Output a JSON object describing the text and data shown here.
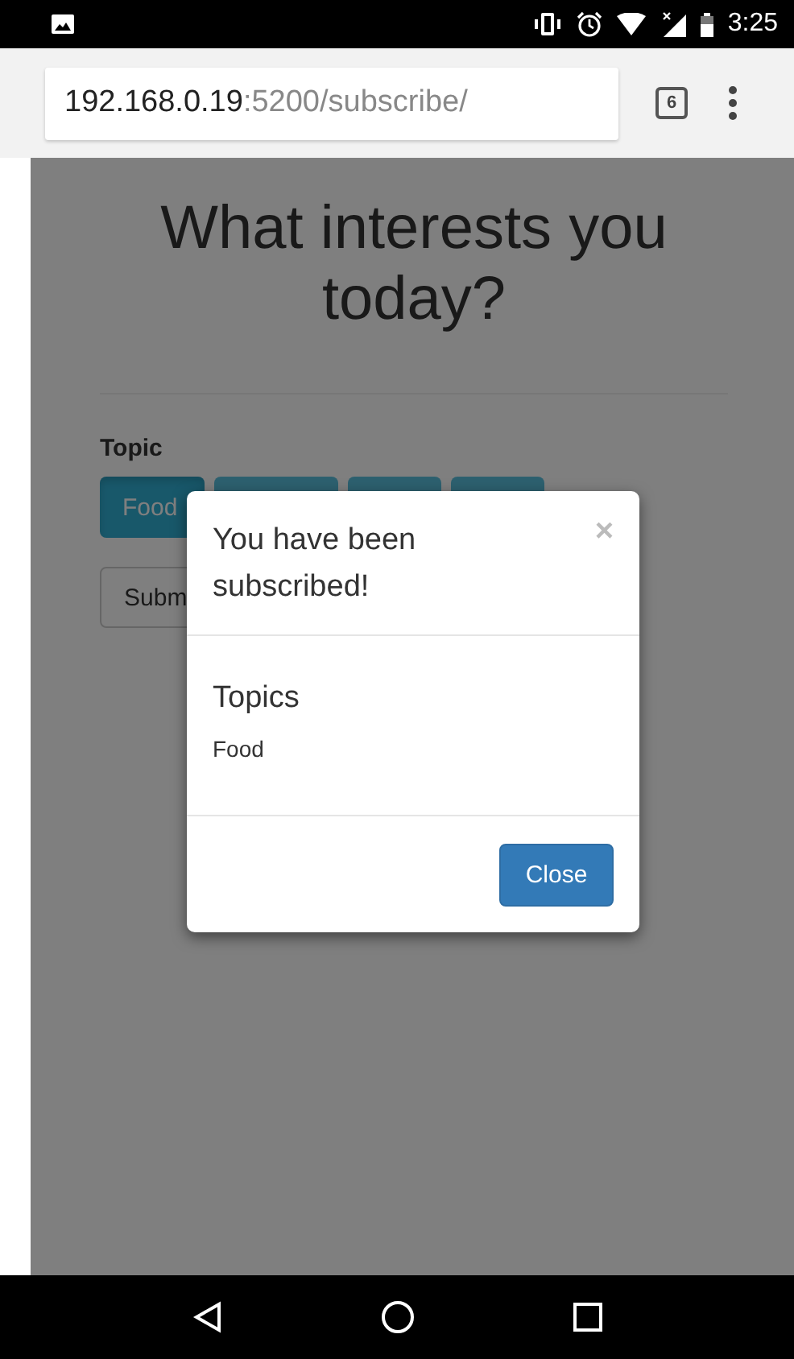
{
  "status_bar": {
    "time": "3:25"
  },
  "address_bar": {
    "host": "192.168.0.19",
    "path": ":5200/subscribe/",
    "tab_count": "6"
  },
  "page": {
    "heading": "What interests you today?",
    "topic_label": "Topic",
    "topics": [
      {
        "label": "Food",
        "selected": true
      },
      {
        "selected": false
      },
      {
        "selected": false
      },
      {
        "selected": false
      }
    ],
    "submit_label": "Subm"
  },
  "modal": {
    "title": "You have been subscribed!",
    "close_glyph": "×",
    "section_title": "Topics",
    "items": [
      "Food"
    ],
    "close_label": "Close"
  }
}
